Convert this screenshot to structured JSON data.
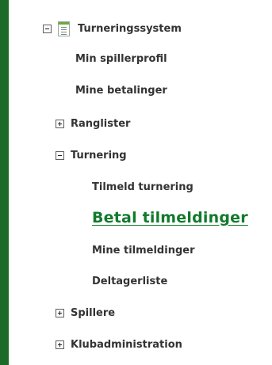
{
  "colors": {
    "accent_bar": "#1c6b28",
    "text": "#333333",
    "active_link": "#117a2c"
  },
  "tree": {
    "root": {
      "label": "Turneringssystem",
      "state": "expanded",
      "icon": "document-icon"
    },
    "root_children": [
      {
        "label": "Min spillerprofil"
      },
      {
        "label": "Mine betalinger"
      }
    ],
    "ranglister": {
      "label": "Ranglister",
      "state": "collapsed"
    },
    "turnering": {
      "label": "Turnering",
      "state": "expanded"
    },
    "turnering_children": [
      {
        "label": "Tilmeld turnering"
      },
      {
        "label": "Betal tilmeldinger",
        "active": true
      },
      {
        "label": "Mine tilmeldinger"
      },
      {
        "label": "Deltagerliste"
      }
    ],
    "spillere": {
      "label": "Spillere",
      "state": "collapsed"
    },
    "klubadministration": {
      "label": "Klubadministration",
      "state": "collapsed"
    }
  }
}
